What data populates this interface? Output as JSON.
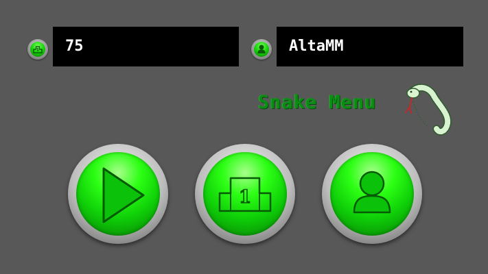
{
  "score_field": {
    "value": "75",
    "icon": "podium-icon"
  },
  "player_field": {
    "value": "AltaMM",
    "icon": "person-icon"
  },
  "menu_title": "Snake Menu",
  "buttons": [
    {
      "name": "play-button",
      "icon": "play-icon"
    },
    {
      "name": "highscores-button",
      "icon": "podium-icon"
    },
    {
      "name": "profile-button",
      "icon": "person-icon"
    }
  ],
  "colors": {
    "background": "#585858",
    "field_bg": "#000000",
    "accent_green": "#1ad70c",
    "title_green": "#0c8c14"
  }
}
